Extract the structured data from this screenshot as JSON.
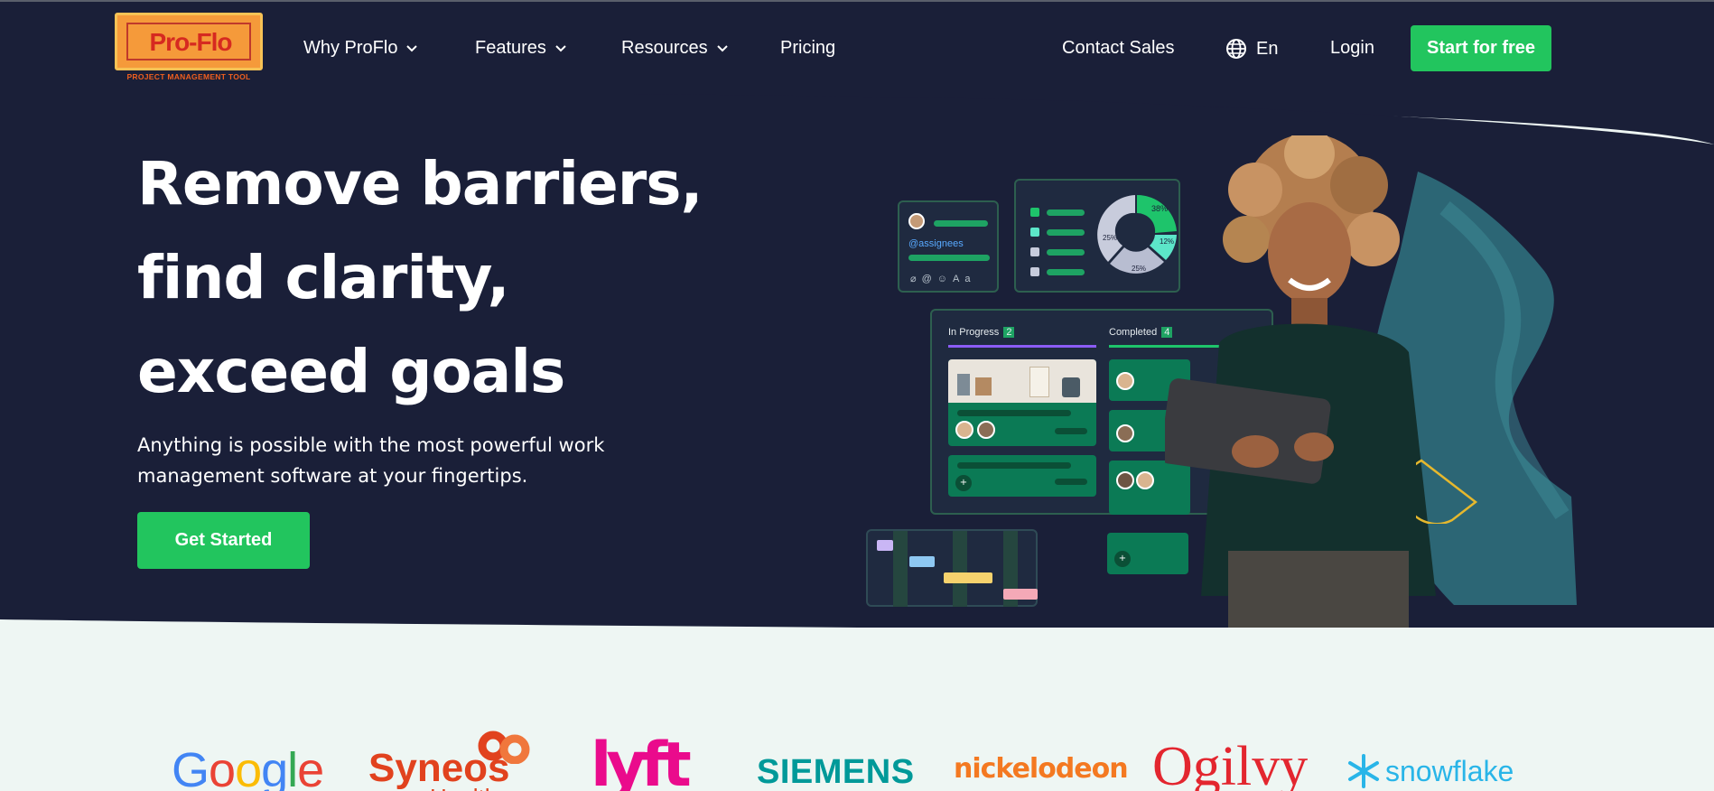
{
  "brand": {
    "logo_text": "Pro-Flo",
    "logo_tagline": "PROJECT MANAGEMENT TOOL",
    "logo_orange": "#f59a3a",
    "logo_red": "#d62a20"
  },
  "nav": {
    "items": [
      {
        "label": "Why ProFlo",
        "dropdown": true
      },
      {
        "label": "Features",
        "dropdown": true
      },
      {
        "label": "Resources",
        "dropdown": true
      },
      {
        "label": "Pricing",
        "dropdown": false
      }
    ],
    "contact_sales": "Contact Sales",
    "language": "En",
    "language_icon": "globe-icon",
    "login": "Login",
    "start_free": "Start for free"
  },
  "hero": {
    "title_lines": [
      "Remove barriers,",
      "find clarity,",
      "exceed goals"
    ],
    "subtitle": "Anything is possible with the most powerful work management software at your fingertips.",
    "cta": "Get Started"
  },
  "mockup": {
    "assignees_tag": "@assignees",
    "composer_icons": [
      "paperclip-icon",
      "at-icon",
      "smiley-icon",
      "Aa"
    ],
    "donut_labels": [
      "38%",
      "12%",
      "25%",
      "25%"
    ],
    "kanban": {
      "columns": [
        {
          "label": "In Progress",
          "count": "2"
        },
        {
          "label": "Completed",
          "count": "4"
        }
      ]
    }
  },
  "customer_logos": [
    "Google",
    "Syneos",
    "Health",
    "lyft",
    "SIEMENS",
    "nickelodeon",
    "Ogilvy",
    "snowflake"
  ],
  "colors": {
    "navy": "#1a1f38",
    "green": "#22c55e",
    "mint_bg": "#eef6f3"
  }
}
